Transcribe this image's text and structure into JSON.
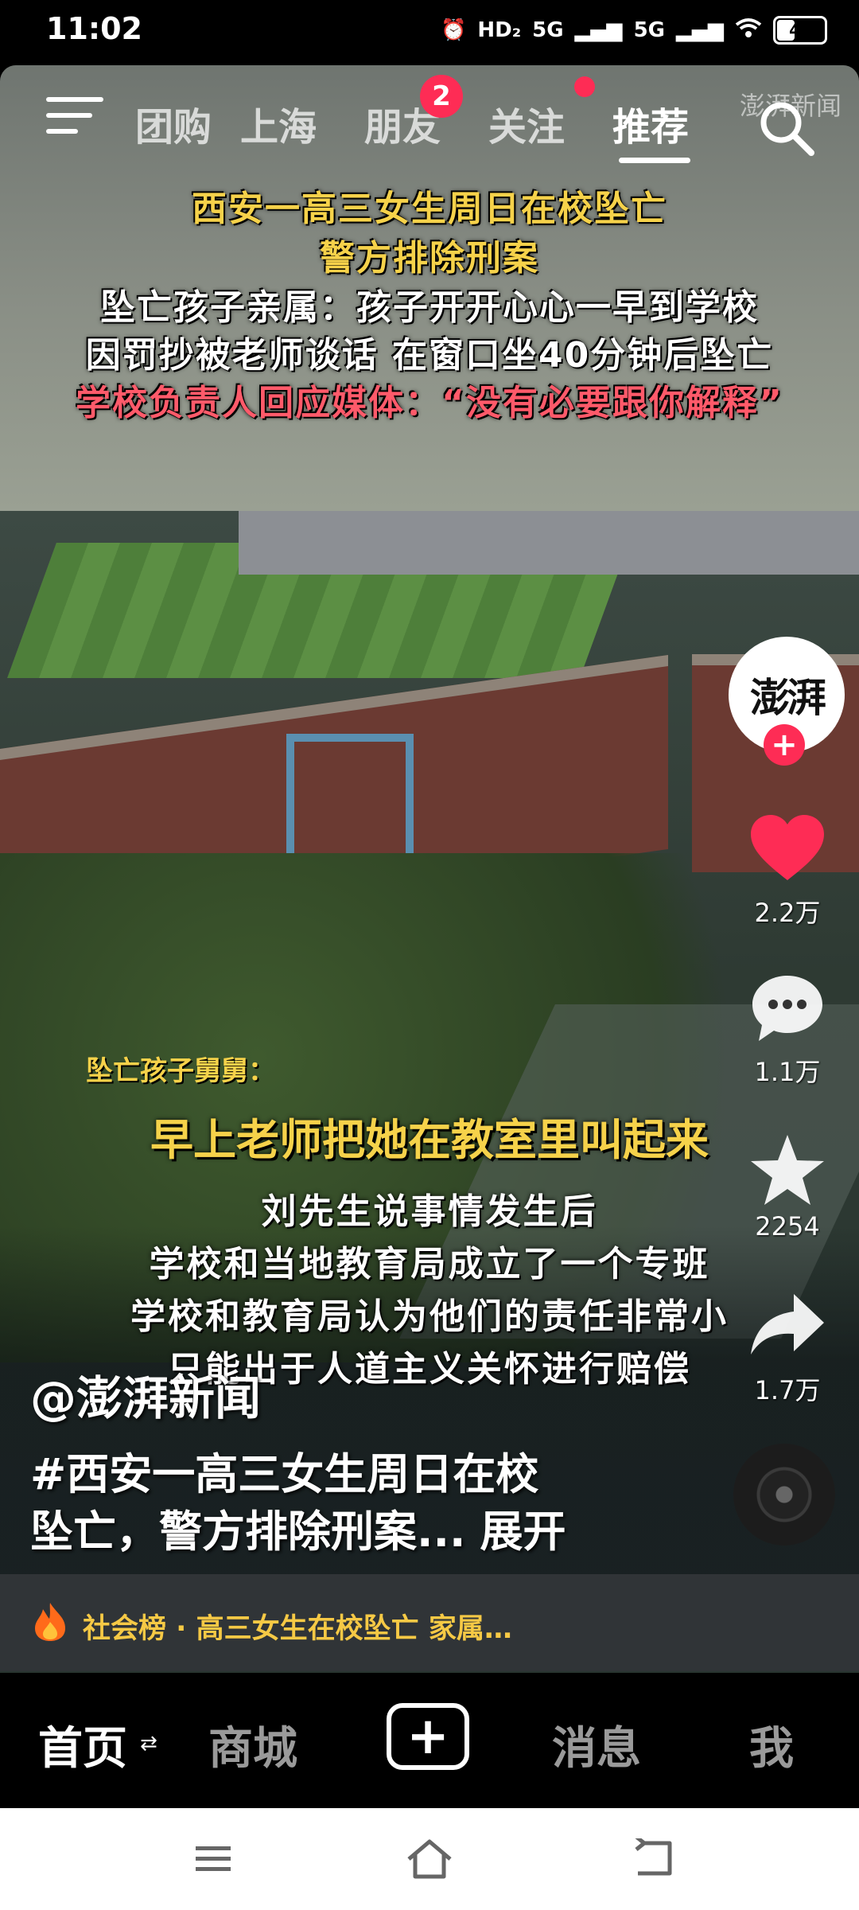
{
  "status_bar": {
    "time": "11:02",
    "network": [
      "HD₂",
      "5G",
      "5G"
    ],
    "battery": "41",
    "battery_level": 0.41
  },
  "top_nav": {
    "tabs": [
      {
        "label": "团购",
        "badge": ""
      },
      {
        "label": "上海",
        "badge": ""
      },
      {
        "label": "朋友",
        "badge": "2"
      },
      {
        "label": "关注",
        "badge": "dot"
      },
      {
        "label": "推荐",
        "badge": "",
        "active": true
      }
    ],
    "watermark": "澎湃新闻",
    "icons": {
      "menu": "menu-icon",
      "search": "search-icon"
    }
  },
  "video": {
    "headline": [
      "西安一高三女生周日在校坠亡",
      "警方排除刑案",
      "坠亡孩子亲属：孩子开开心心一早到学校",
      "因罚抄被老师谈话 在窗口坐40分钟后坠亡",
      "学校负责人回应媒体：“没有必要跟你解释”"
    ],
    "subtitle_speaker": "坠亡孩子舅舅：",
    "subtitle_main": "早上老师把她在教室里叫起来",
    "subtitles": [
      "刘先生说事情发生后",
      "学校和当地教育局成立了一个专班",
      "学校和教育局认为他们的责任非常小",
      "只能出于人道主义关怀进行赔偿"
    ]
  },
  "right_rail": {
    "avatar_text": "澎湃",
    "follow_plus": "+",
    "like_count": "2.2万",
    "comment_count": "1.1万",
    "favorite_count": "2254",
    "share_count": "1.7万",
    "like_color": "#fe2c55"
  },
  "post": {
    "author": "@澎湃新闻",
    "title_line1": "#西安一高三女生周日在校",
    "title_line2": "坠亡，警方排除刑案...",
    "expand": "展开"
  },
  "hot_bar": {
    "text": "社会榜 · 高三女生在校坠亡 家属…",
    "icon": "fire-icon",
    "color": "#f6c945"
  },
  "bottom_tabs": {
    "home": "首页",
    "home_arrows": "⇄",
    "mall": "商城",
    "create": "+",
    "messages": "消息",
    "me": "我"
  },
  "system_nav": {
    "icons": [
      "menu-icon",
      "home-icon",
      "back-icon"
    ]
  }
}
